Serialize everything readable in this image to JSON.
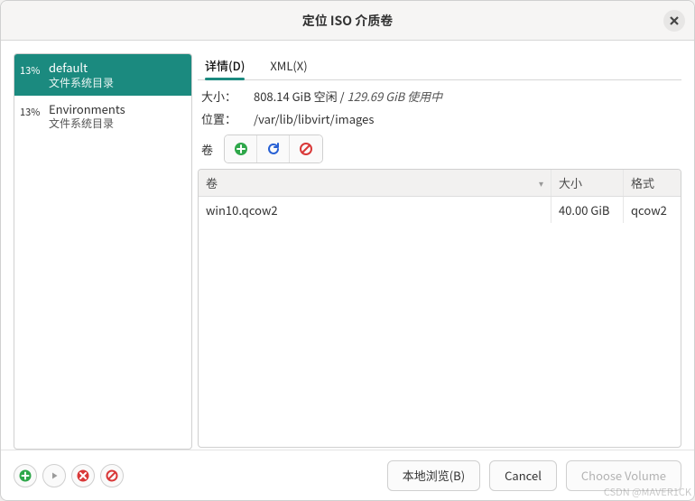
{
  "window": {
    "title": "定位 ISO 介质卷"
  },
  "sidebar": {
    "items": [
      {
        "percent": "13%",
        "name": "default",
        "subtitle": "文件系统目录",
        "active": true
      },
      {
        "percent": "13%",
        "name": "Environments",
        "subtitle": "文件系统目录",
        "active": false
      }
    ]
  },
  "tabs": [
    {
      "label": "详情(D)",
      "active": true
    },
    {
      "label": "XML(X)",
      "active": false
    }
  ],
  "details": {
    "size_label": "大小：",
    "size_free": "808.14 GiB 空闲",
    "size_sep": " / ",
    "size_used": "129.69 GiB 使用中",
    "location_label": "位置：",
    "location_value": "/var/lib/libvirt/images",
    "vol_toolbar_label": "卷"
  },
  "columns": {
    "name": "卷",
    "size": "大小",
    "format": "格式"
  },
  "volumes": [
    {
      "name": "win10.qcow2",
      "size": "40.00 GiB",
      "format": "qcow2"
    }
  ],
  "footer": {
    "browse": "本地浏览(B)",
    "cancel": "Cancel",
    "choose": "Choose Volume"
  },
  "icons": {
    "add": "add-icon",
    "refresh": "refresh-icon",
    "delete": "delete-icon",
    "play": "play-icon",
    "stop": "stop-icon",
    "forbid": "forbid-icon"
  },
  "watermark": "CSDN @MAVER1CK"
}
